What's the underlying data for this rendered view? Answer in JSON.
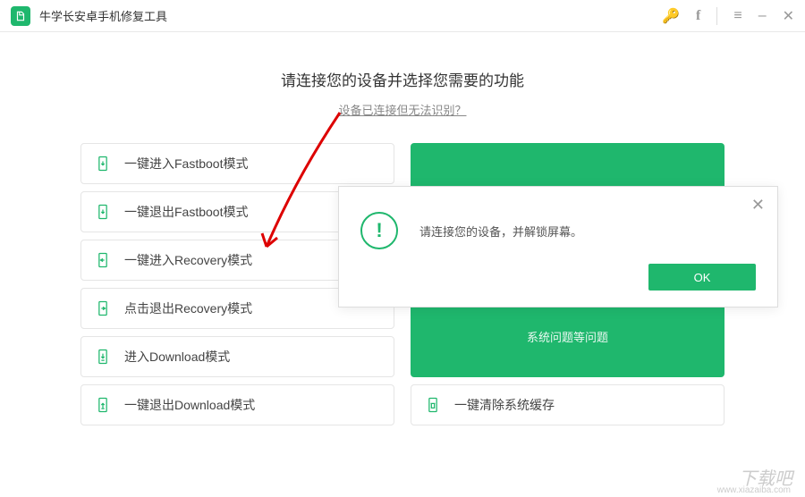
{
  "titlebar": {
    "title": "牛学长安卓手机修复工具"
  },
  "main": {
    "heading": "请连接您的设备并选择您需要的功能",
    "subheading": "设备已连接但无法识别？"
  },
  "options": {
    "fastboot_enter": "一键进入Fastboot模式",
    "fastboot_exit": "一键退出Fastboot模式",
    "recovery_enter": "一键进入Recovery模式",
    "recovery_exit": "点击退出Recovery模式",
    "download_enter": "进入Download模式",
    "download_exit": "一键退出Download模式",
    "clear_cache": "一键清除系统缓存"
  },
  "green_panel": {
    "footer_text": "系统问题等问题"
  },
  "dialog": {
    "message": "请连接您的设备，并解锁屏幕。",
    "ok": "OK"
  },
  "watermark": {
    "text": "下载吧",
    "url": "www.xiazaiba.com"
  }
}
